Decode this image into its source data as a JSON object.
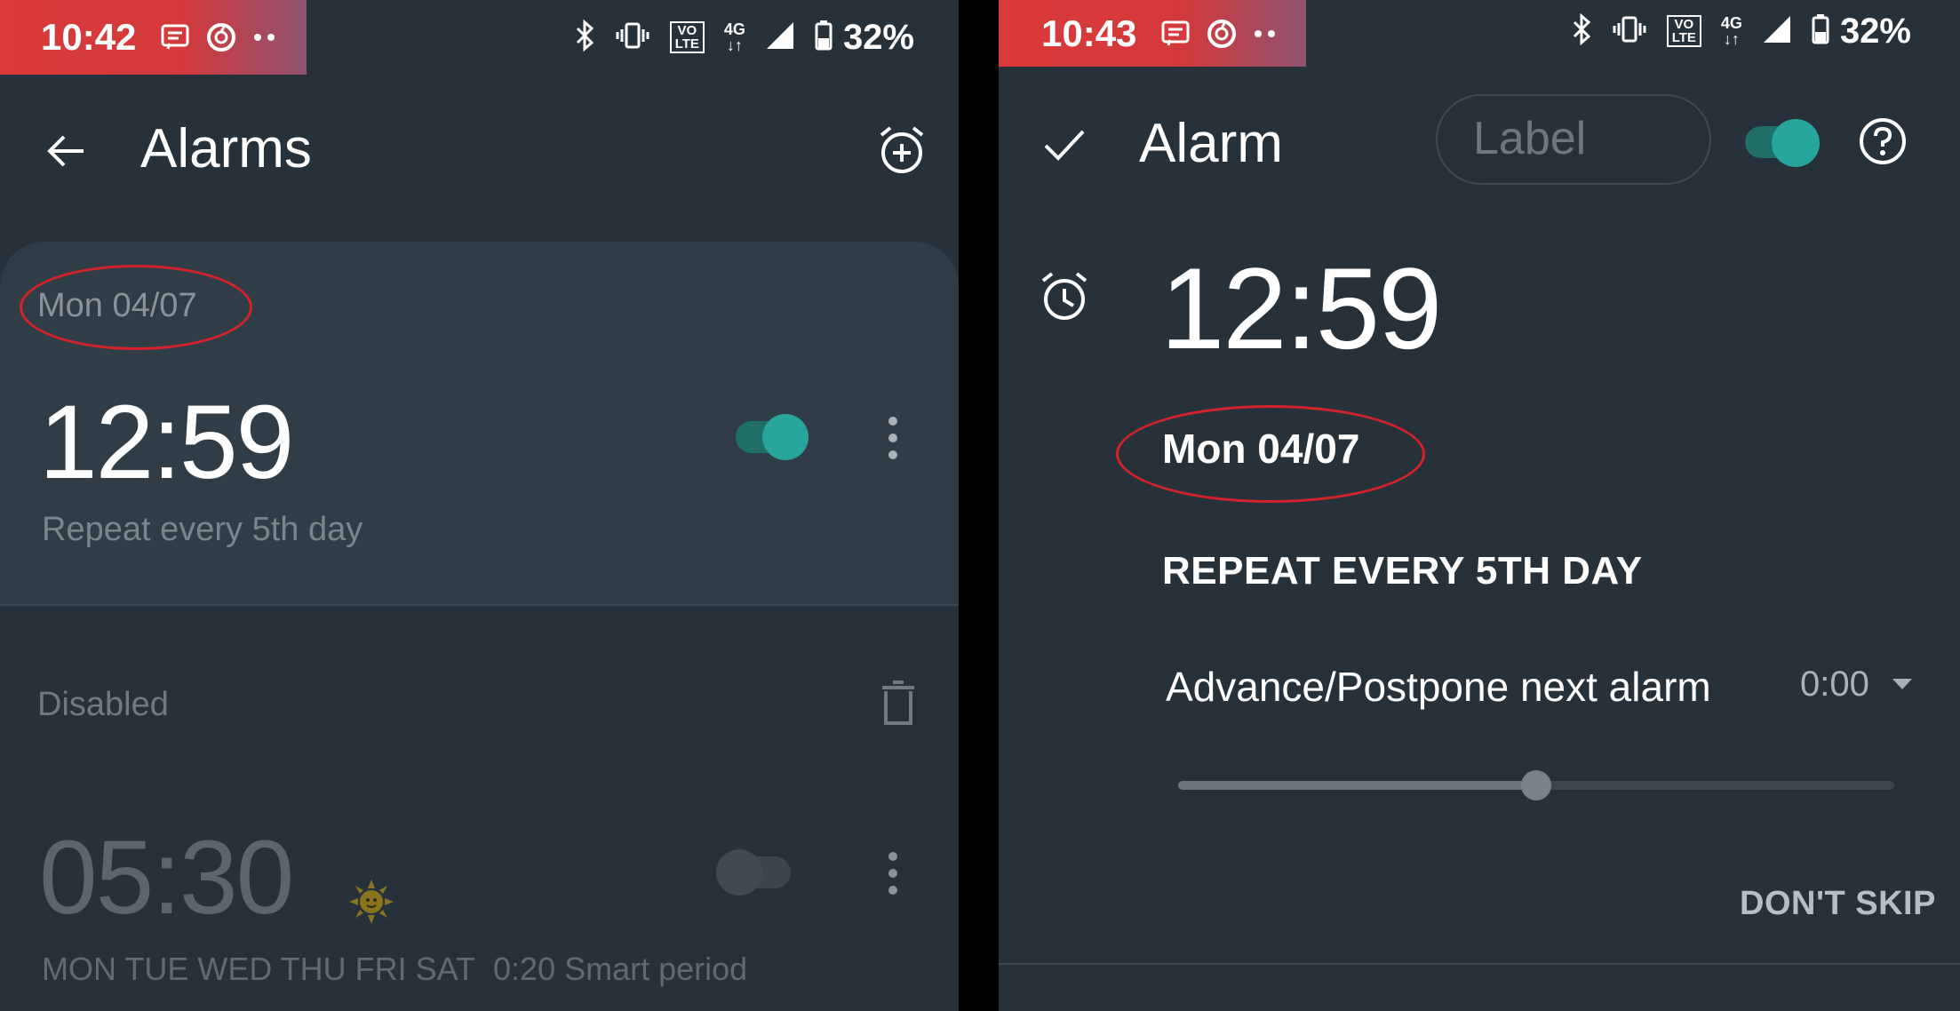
{
  "left": {
    "status": {
      "time": "10:42",
      "battery": "32%",
      "volte": "VO\nLTE",
      "network": "4G"
    },
    "title": "Alarms",
    "alarm_active": {
      "date": "Mon 04/07",
      "time": "12:59",
      "repeat": "Repeat every 5th day",
      "enabled": true
    },
    "disabled_section": {
      "label": "Disabled",
      "alarm": {
        "time": "05:30",
        "days": "MON TUE WED THU FRI SAT",
        "smart_period": "0:20 Smart period",
        "enabled": false
      }
    }
  },
  "right": {
    "status": {
      "time": "10:43",
      "battery": "32%",
      "volte": "VO\nLTE",
      "network": "4G"
    },
    "title": "Alarm",
    "label_placeholder": "Label",
    "enabled": true,
    "time": "12:59",
    "date": "Mon 04/07",
    "repeat": "REPEAT EVERY 5TH DAY",
    "advance_label": "Advance/Postpone next alarm",
    "advance_value": "0:00",
    "slider_fraction": 0.5,
    "dont_skip": "DON'T SKIP"
  },
  "colors": {
    "accent": "#26a69a",
    "background": "#27313a",
    "card": "#303d46",
    "status_red": "#d93a3a",
    "annotation_red": "#d4222b"
  }
}
